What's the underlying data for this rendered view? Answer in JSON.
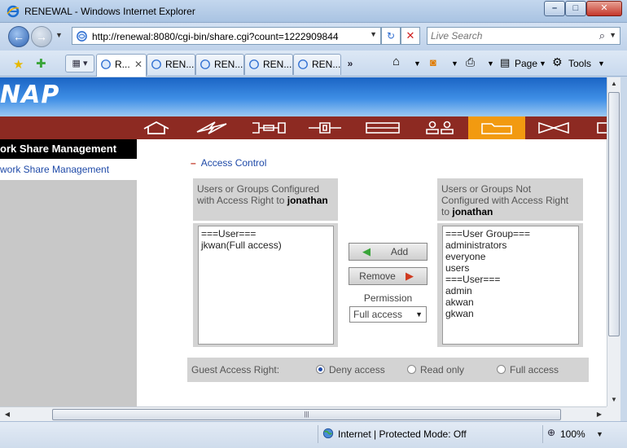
{
  "window": {
    "title": "RENEWAL - Windows Internet Explorer"
  },
  "address": {
    "url": "http://renewal:8080/cgi-bin/share.cgi?count=1222909844"
  },
  "search": {
    "placeholder": "Live Search"
  },
  "tabs": [
    {
      "label": "R..."
    },
    {
      "label": "REN..."
    },
    {
      "label": "REN..."
    },
    {
      "label": "REN..."
    },
    {
      "label": "REN..."
    }
  ],
  "tab_more": "»",
  "commands": {
    "page": "Page",
    "tools": "Tools"
  },
  "brand": "NAP",
  "sidebar": {
    "header": "ork Share Management",
    "item": "work Share Management"
  },
  "access_control": {
    "title": "Access Control",
    "configured_header": "Users or Groups Configured with Access Right to",
    "not_configured_header": "Users or Groups Not Configured with Access Right to",
    "share_name": "jonathan",
    "configured_list": [
      "===User===",
      "jkwan(Full access)"
    ],
    "available_list": [
      "===User Group===",
      "administrators",
      "everyone",
      "users",
      "===User===",
      "admin",
      "akwan",
      "gkwan"
    ],
    "add_label": "Add",
    "remove_label": "Remove",
    "permission_label": "Permission",
    "permission_value": "Full access"
  },
  "guest": {
    "label": "Guest Access Right:",
    "options": [
      "Deny access",
      "Read only",
      "Full access"
    ],
    "selected": "Deny access"
  },
  "status": {
    "zone": "Internet | Protected Mode: Off",
    "zoom": "100%"
  },
  "colors": {
    "menubar": "#8d2a22",
    "active_menu": "#f29a10",
    "link": "#1f4aa8",
    "banner": "#2a78d8"
  }
}
